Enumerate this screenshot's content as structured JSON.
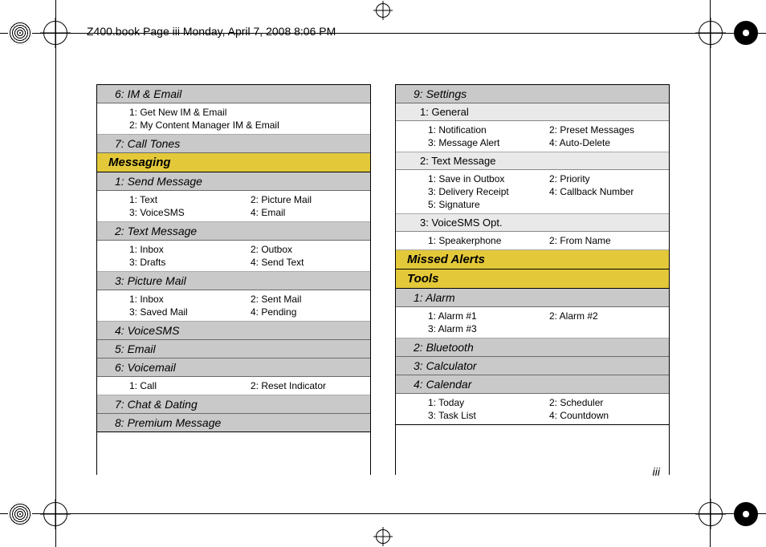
{
  "header": "Z400.book  Page iii  Monday, April 7, 2008  8:06 PM",
  "page_number": "iii",
  "left": {
    "im_email": {
      "title": "6: IM & Email",
      "items": [
        "1: Get New IM & Email",
        "2: My Content Manager IM & Email"
      ]
    },
    "call_tones": "7: Call Tones",
    "messaging": "Messaging",
    "send_msg": {
      "title": "1: Send Message",
      "items": [
        "1: Text",
        "2: Picture Mail",
        "3: VoiceSMS",
        "4: Email"
      ]
    },
    "text_msg": {
      "title": "2: Text Message",
      "items": [
        "1: Inbox",
        "2: Outbox",
        "3: Drafts",
        "4: Send Text"
      ]
    },
    "pic_mail": {
      "title": "3: Picture Mail",
      "items": [
        "1: Inbox",
        "2: Sent Mail",
        "3: Saved Mail",
        "4: Pending"
      ]
    },
    "voicesms": "4: VoiceSMS",
    "email": "5: Email",
    "voicemail": {
      "title": "6: Voicemail",
      "items": [
        "1: Call",
        "2: Reset Indicator"
      ]
    },
    "chat": "7: Chat & Dating",
    "premium": "8: Premium Message"
  },
  "right": {
    "settings": "9: Settings",
    "general": {
      "title": "1: General",
      "items": [
        "1: Notification",
        "2: Preset Messages",
        "3: Message Alert",
        "4: Auto-Delete"
      ]
    },
    "textmsg": {
      "title": "2: Text Message",
      "items": [
        "1: Save in Outbox",
        "2: Priority",
        "3: Delivery Receipt",
        "4: Callback Number",
        "5: Signature",
        ""
      ]
    },
    "vsmsopt": {
      "title": "3: VoiceSMS Opt.",
      "items": [
        "1: Speakerphone",
        "2: From Name"
      ]
    },
    "missed": "Missed Alerts",
    "tools": "Tools",
    "alarm": {
      "title": "1: Alarm",
      "items": [
        "1: Alarm #1",
        "2: Alarm #2",
        "3: Alarm #3",
        ""
      ]
    },
    "bluetooth": "2: Bluetooth",
    "calculator": "3: Calculator",
    "calendar": {
      "title": "4: Calendar",
      "items": [
        "1: Today",
        "2: Scheduler",
        "3: Task List",
        "4: Countdown"
      ]
    }
  }
}
